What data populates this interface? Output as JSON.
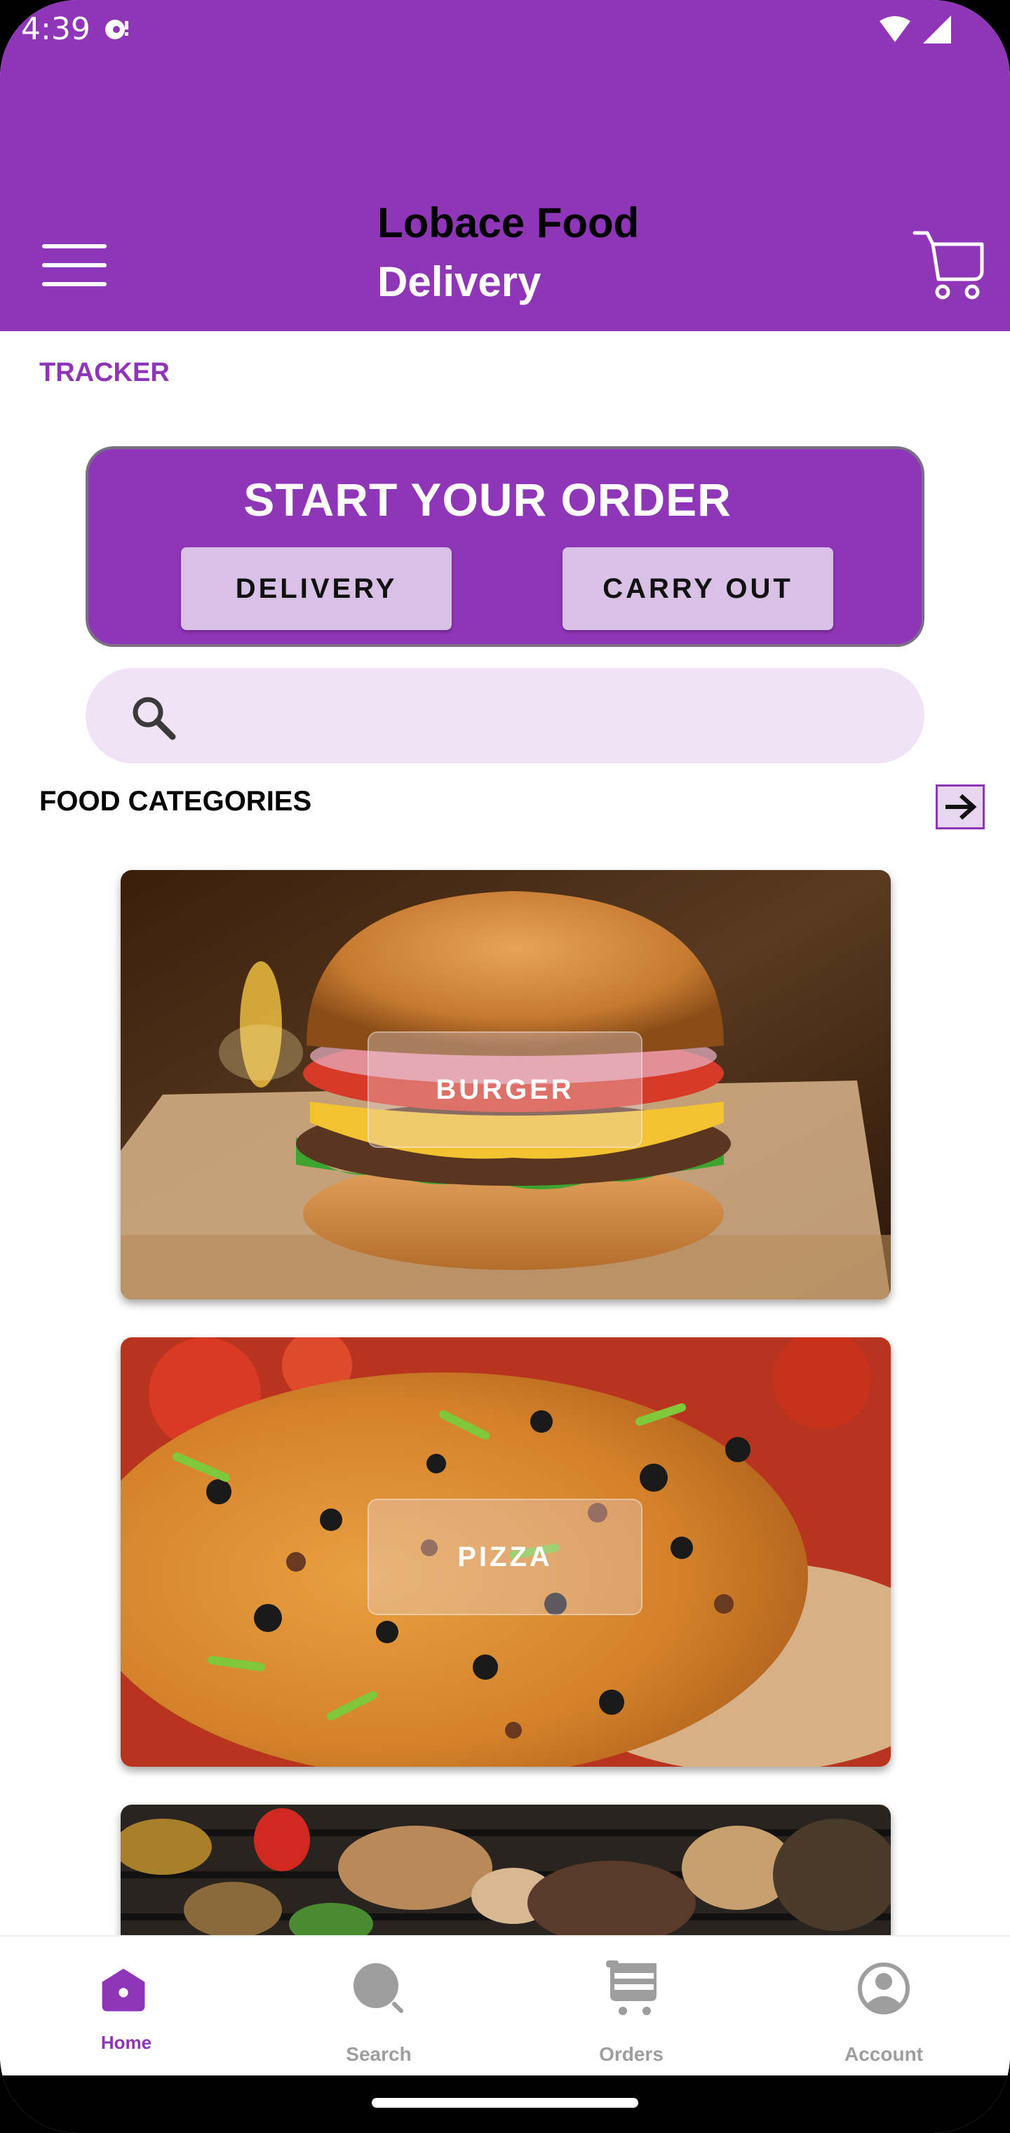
{
  "status_bar": {
    "time": "4:39"
  },
  "app_bar": {
    "title_line1": "Lobace Food",
    "title_line2": "Delivery",
    "menu_icon": "hamburger-menu-icon",
    "cart_icon": "shopping-cart-icon"
  },
  "tracker_link": "TRACKER",
  "order_card": {
    "title": "START YOUR ORDER",
    "delivery_label": "DELIVERY",
    "carry_out_label": "CARRY OUT"
  },
  "search": {
    "placeholder": "",
    "value": "",
    "icon": "search-icon"
  },
  "categories": {
    "heading": "FOOD CATEGORIES",
    "arrow_icon": "arrow-right-icon",
    "items": [
      {
        "label": "BURGER"
      },
      {
        "label": "PIZZA"
      },
      {
        "label": ""
      }
    ]
  },
  "bottom_nav": {
    "items": [
      {
        "label": "Home",
        "icon": "home-icon",
        "active": true
      },
      {
        "label": "Search",
        "icon": "search-icon",
        "active": false
      },
      {
        "label": "Orders",
        "icon": "cart-icon",
        "active": false
      },
      {
        "label": "Account",
        "icon": "account-icon",
        "active": false
      }
    ]
  },
  "colors": {
    "primary": "#8F35B7",
    "button_bg": "#D9C1E5",
    "search_bg": "#EFE3F5",
    "nav_inactive": "#9E9E9E"
  }
}
